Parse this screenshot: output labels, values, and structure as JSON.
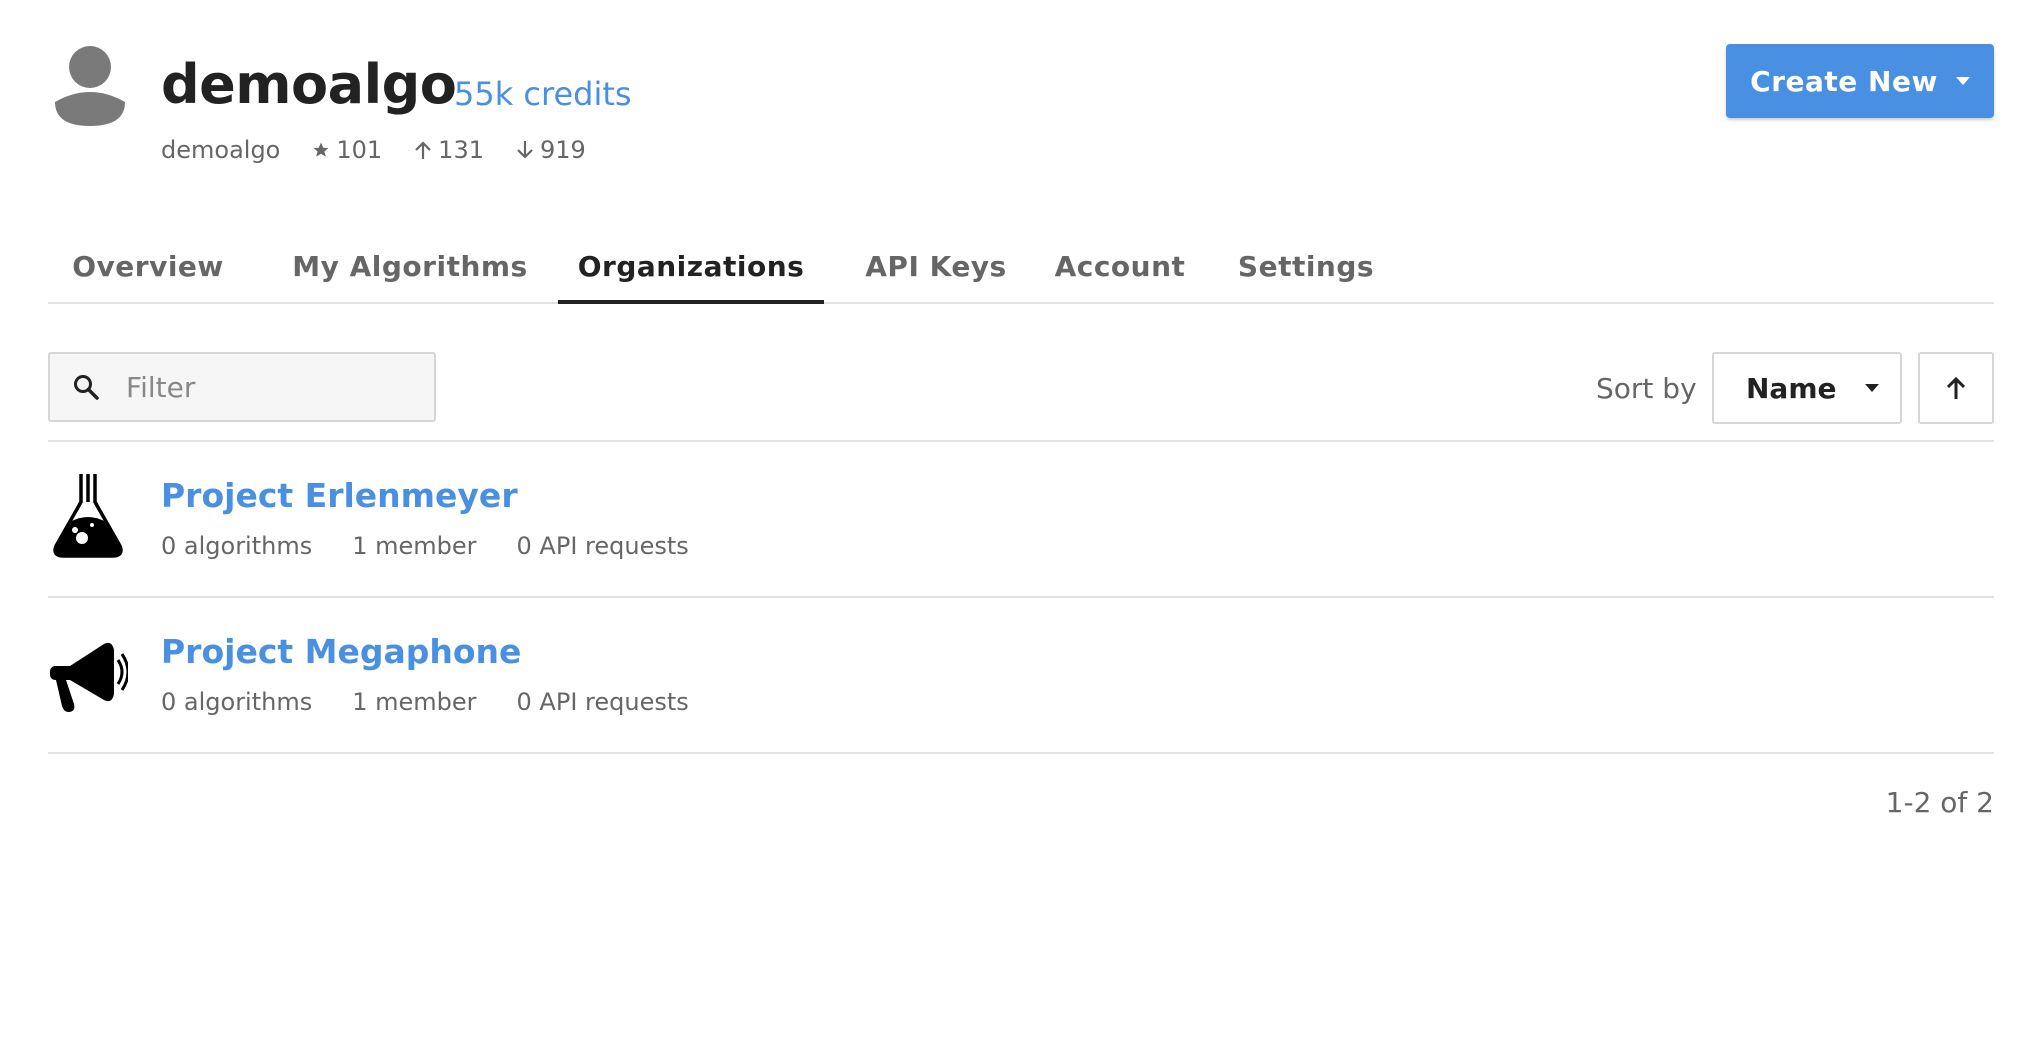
{
  "profile": {
    "username": "demoalgo",
    "credits": "55k credits",
    "handle": "demoalgo",
    "stars": "101",
    "upvotes": "131",
    "downvotes": "919"
  },
  "actions": {
    "create_label": "Create New"
  },
  "tabs": [
    {
      "label": "Overview",
      "active": false
    },
    {
      "label": "My Algorithms",
      "active": false
    },
    {
      "label": "Organizations",
      "active": true
    },
    {
      "label": "API Keys",
      "active": false
    },
    {
      "label": "Account",
      "active": false
    },
    {
      "label": "Settings",
      "active": false
    }
  ],
  "filter": {
    "placeholder": "Filter",
    "value": ""
  },
  "sort": {
    "label": "Sort by",
    "selected": "Name",
    "direction": "ascending"
  },
  "organizations": [
    {
      "name": "Project Erlenmeyer",
      "icon": "flask-icon",
      "algorithms": "0 algorithms",
      "members": "1 member",
      "requests": "0 API requests"
    },
    {
      "name": "Project Megaphone",
      "icon": "megaphone-icon",
      "algorithms": "0 algorithms",
      "members": "1 member",
      "requests": "0 API requests"
    }
  ],
  "pagination": {
    "text": "1-2 of 2"
  },
  "colors": {
    "accent": "#4a90e2",
    "text": "#222222",
    "muted": "#666666",
    "border": "#e2e2e2"
  }
}
